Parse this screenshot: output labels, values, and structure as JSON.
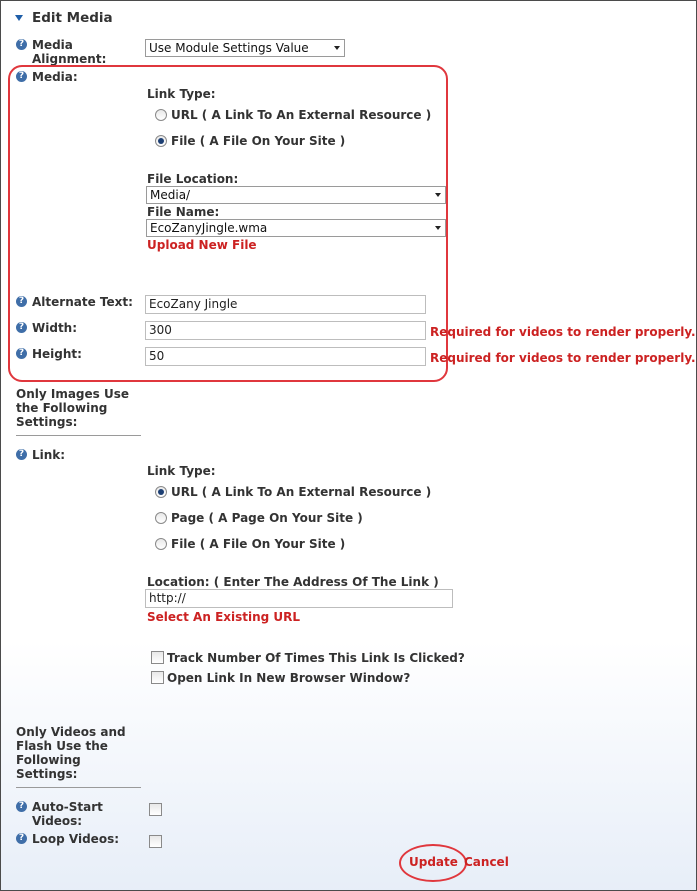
{
  "header": {
    "title": "Edit Media"
  },
  "media_alignment": {
    "label": "Media Alignment:",
    "selected": "Use Module Settings Value"
  },
  "media": {
    "label": "Media:",
    "link_type_label": "Link Type:",
    "options": [
      {
        "label": "URL ( A Link To An External Resource )",
        "selected": false
      },
      {
        "label": "File ( A File On Your Site )",
        "selected": true
      }
    ],
    "file_location_label": "File Location:",
    "file_location_value": "Media/",
    "file_name_label": "File Name:",
    "file_name_value": "EcoZanyJingle.wma",
    "upload_link": "Upload New File"
  },
  "alternate_text": {
    "label": "Alternate Text:",
    "value": "EcoZany Jingle"
  },
  "width": {
    "label": "Width:",
    "value": "300",
    "note": "Required for videos to render properly."
  },
  "height": {
    "label": "Height:",
    "value": "50",
    "note": "Required for videos to render properly."
  },
  "images_section": {
    "title_lines": [
      "Only Images Use",
      "the Following",
      "Settings:"
    ]
  },
  "link": {
    "label": "Link:",
    "link_type_label": "Link Type:",
    "options": [
      {
        "label": "URL ( A Link To An External Resource )",
        "selected": true
      },
      {
        "label": "Page ( A Page On Your Site )",
        "selected": false
      },
      {
        "label": "File ( A File On Your Site )",
        "selected": false
      }
    ],
    "location_label": "Location: ( Enter The Address Of The Link )",
    "location_value": "http://",
    "select_existing": "Select An Existing URL",
    "track_label": "Track Number Of Times This Link Is Clicked?",
    "new_window_label": "Open Link In New Browser Window?"
  },
  "videos_section": {
    "title_lines": [
      "Only Videos and",
      "Flash Use the",
      "Following",
      "Settings:"
    ]
  },
  "auto_start": {
    "label_lines": [
      "Auto-Start",
      "Videos:"
    ]
  },
  "loop": {
    "label": "Loop Videos:"
  },
  "actions": {
    "update": "Update",
    "cancel": "Cancel"
  },
  "icons": {
    "help": "?",
    "help_icon": "help-question-icon"
  },
  "colors": {
    "highlight_ring": "#e0373d",
    "link_red": "#cc2222",
    "help_blue": "#3f6ea8"
  }
}
